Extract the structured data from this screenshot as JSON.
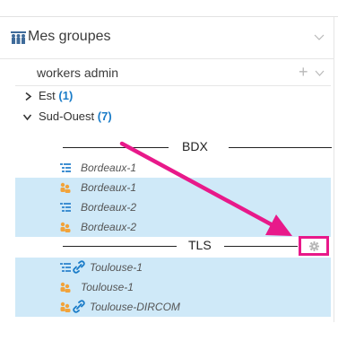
{
  "header": {
    "title": "Mes groupes"
  },
  "subheader": {
    "title": "workers admin",
    "plus": "+"
  },
  "tree": [
    {
      "label": "Est",
      "count": "(1)",
      "expanded": false
    },
    {
      "label": "Sud-Ouest",
      "count": "(7)",
      "expanded": true
    }
  ],
  "sections": [
    {
      "label": "BDX",
      "items": [
        {
          "icon": "list-icon",
          "label": "Bordeaux-1",
          "selected": false
        },
        {
          "icon": "users-icon",
          "label": "Bordeaux-1",
          "selected": true
        },
        {
          "icon": "list-icon",
          "label": "Bordeaux-2",
          "selected": true
        },
        {
          "icon": "users-icon",
          "label": "Bordeaux-2",
          "selected": true
        }
      ]
    },
    {
      "label": "TLS",
      "items": [
        {
          "icon": "list-icon",
          "link": true,
          "label": "Toulouse-1",
          "selected": true
        },
        {
          "icon": "users-icon",
          "label": "Toulouse-1",
          "selected": true
        },
        {
          "icon": "users-icon",
          "link": true,
          "label": "Toulouse-DIRCOM",
          "selected": true
        }
      ]
    }
  ],
  "colors": {
    "selected_row": "#cfe9f8",
    "count": "#1a7cc8",
    "link": "#1a7cc8",
    "users_icon": "#f2a33a",
    "list_icon": "#3f8fd2",
    "highlight": "#e8198a"
  }
}
